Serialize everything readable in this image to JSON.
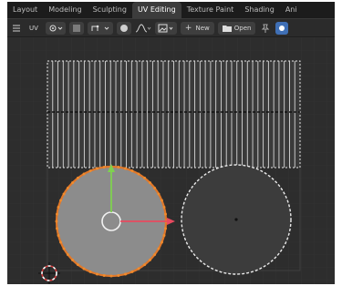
{
  "tabs": [
    "Layout",
    "Modeling",
    "Sculpting",
    "UV Editing",
    "Texture Paint",
    "Shading",
    "Ani"
  ],
  "active_tab": "UV Editing",
  "toolbar": {
    "editor_label": "UV",
    "new_label": "New",
    "open_label": "Open"
  },
  "colors": {
    "background": "#2d2d2d",
    "selected_edge": "#e0782a",
    "face_fill": "#8a8a8a",
    "x_axis": "#e84a5f",
    "y_axis": "#7fd14f"
  }
}
